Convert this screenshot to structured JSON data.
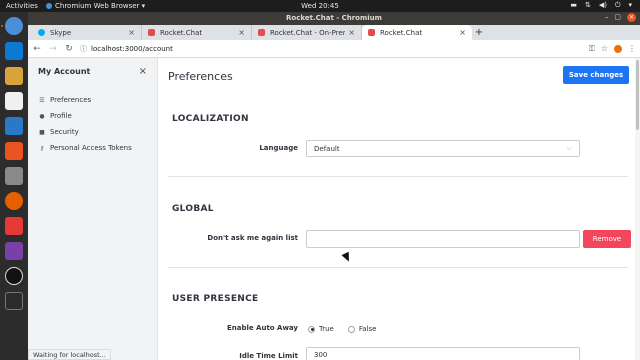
{
  "topbar": {
    "activities": "Activities",
    "app_name": "Chromium Web Browser ▾",
    "clock": "Wed 20:45"
  },
  "window": {
    "title": "Rocket.Chat - Chromium"
  },
  "tabs": [
    {
      "label": "Skype",
      "color": "#00aff0"
    },
    {
      "label": "Rocket.Chat",
      "color": "#e34c4c"
    },
    {
      "label": "Rocket.Chat - On-Premise",
      "color": "#e34c4c"
    },
    {
      "label": "Rocket.Chat",
      "color": "#e34c4c"
    }
  ],
  "address": {
    "url": "localhost:3000/account"
  },
  "sidebar": {
    "title": "My Account",
    "items": [
      {
        "label": "Preferences",
        "icon": "sliders-icon"
      },
      {
        "label": "Profile",
        "icon": "user-icon"
      },
      {
        "label": "Security",
        "icon": "lock-icon"
      },
      {
        "label": "Personal Access Tokens",
        "icon": "key-icon"
      }
    ]
  },
  "main": {
    "title": "Preferences",
    "save_label": "Save changes",
    "localization": {
      "title": "LOCALIZATION",
      "language_label": "Language",
      "language_value": "Default"
    },
    "global": {
      "title": "GLOBAL",
      "dont_ask_label": "Don't ask me again list",
      "remove_label": "Remove"
    },
    "user_presence": {
      "title": "USER PRESENCE",
      "auto_away_label": "Enable Auto Away",
      "true_label": "True",
      "false_label": "False",
      "auto_away_selected": "True",
      "idle_label": "Idle Time Limit",
      "idle_value": "300"
    }
  },
  "status": "Waiting for localhost...",
  "colors": {
    "accent": "#1d74f5",
    "danger": "#f5455c",
    "ubuntu_orange": "#e95420"
  }
}
